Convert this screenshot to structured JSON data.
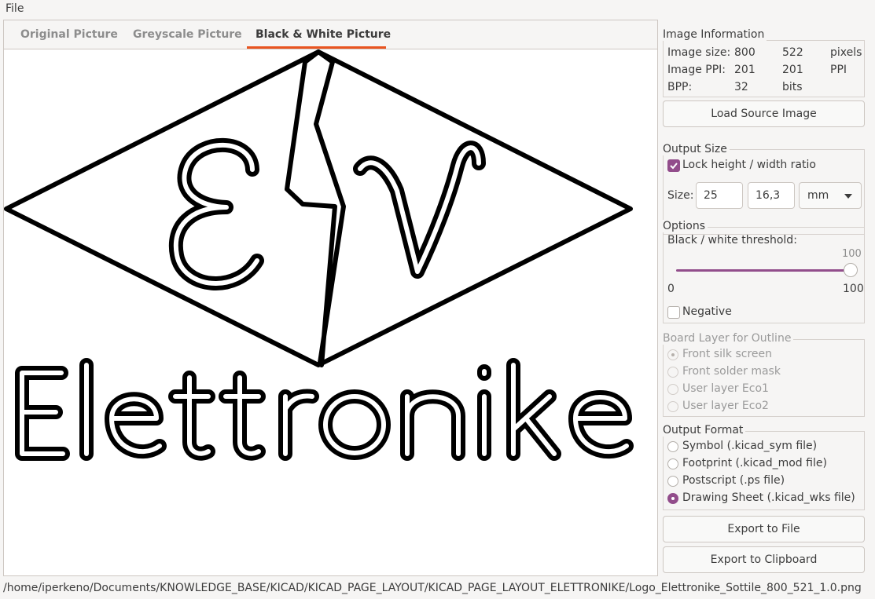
{
  "menu": {
    "file": "File"
  },
  "tabs": [
    {
      "label": "Original Picture"
    },
    {
      "label": "Greyscale Picture"
    },
    {
      "label": "Black & White Picture"
    }
  ],
  "preview_text": "Elettronike",
  "image_info": {
    "title": "Image Information",
    "size_label": "Image size:",
    "size_w": "800",
    "size_h": "522",
    "size_unit": "pixels",
    "ppi_label": "Image PPI:",
    "ppi_x": "201",
    "ppi_y": "201",
    "ppi_unit": "PPI",
    "bpp_label": "BPP:",
    "bpp_value": "32",
    "bpp_unit": "bits"
  },
  "load_button": "Load Source Image",
  "output_size": {
    "title": "Output Size",
    "lock_label": "Lock height / width ratio",
    "size_label": "Size:",
    "width": "25",
    "height": "16,3",
    "unit": "mm"
  },
  "options": {
    "title": "Options",
    "threshold_label": "Black / white threshold:",
    "threshold_value": "100",
    "min": "0",
    "max": "100",
    "threshold_fraction": 1.0,
    "negative_label": "Negative"
  },
  "board_layer": {
    "title": "Board Layer for Outline",
    "options": [
      "Front silk screen",
      "Front solder mask",
      "User layer Eco1",
      "User layer Eco2"
    ]
  },
  "output_format": {
    "title": "Output Format",
    "options": [
      "Symbol (.kicad_sym file)",
      "Footprint (.kicad_mod file)",
      "Postscript (.ps file)",
      "Drawing Sheet (.kicad_wks file)"
    ]
  },
  "export_file": "Export to File",
  "export_clipboard": "Export to Clipboard",
  "status_path": "/home/iperkeno/Documents/KNOWLEDGE_BASE/KICAD/KICAD_PAGE_LAYOUT/KICAD_PAGE_LAYOUT_ELETTRONIKE/Logo_Elettronike_Sottile_800_521_1.0.png",
  "colors": {
    "accent": "#924d8b",
    "tab_underline": "#e95420"
  }
}
